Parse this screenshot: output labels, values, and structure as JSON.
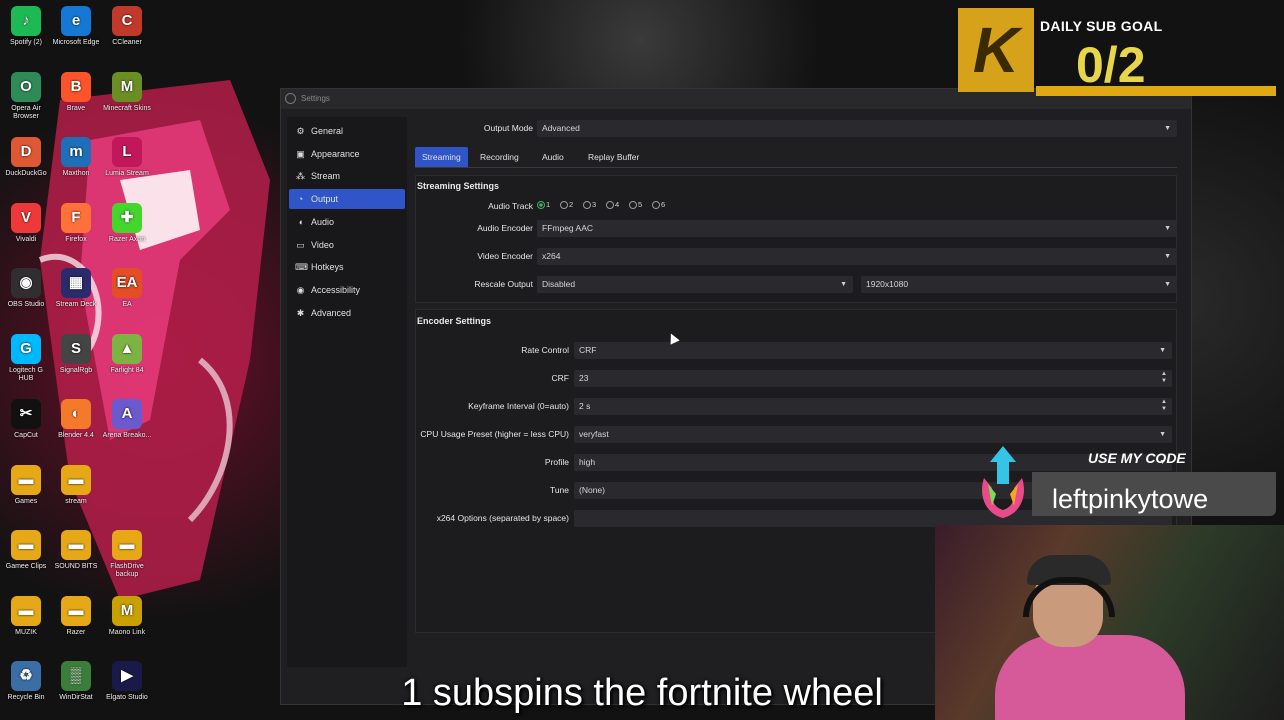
{
  "desktop": {
    "icons": [
      {
        "label": "Spotify (2)",
        "glyph": "♪",
        "color": "#1db954"
      },
      {
        "label": "Microsoft Edge",
        "glyph": "e",
        "color": "#1478d4"
      },
      {
        "label": "CCleaner",
        "glyph": "C",
        "color": "#c0392b"
      },
      {
        "label": "Opera Air Browser",
        "glyph": "O",
        "color": "#2e8b57"
      },
      {
        "label": "Brave",
        "glyph": "B",
        "color": "#fb542b"
      },
      {
        "label": "Minecraft Skins",
        "glyph": "M",
        "color": "#6b8e23"
      },
      {
        "label": "DuckDuckGo",
        "glyph": "D",
        "color": "#de5833"
      },
      {
        "label": "Maxthon",
        "glyph": "m",
        "color": "#1d6fb8"
      },
      {
        "label": "Lumia Stream",
        "glyph": "L",
        "color": "#c2185b"
      },
      {
        "label": "Vivaldi",
        "glyph": "V",
        "color": "#ef3939"
      },
      {
        "label": "Firefox",
        "glyph": "F",
        "color": "#ff7139"
      },
      {
        "label": "Razer Axon",
        "glyph": "✚",
        "color": "#44d62c"
      },
      {
        "label": "OBS Studio",
        "glyph": "◉",
        "color": "#302e31"
      },
      {
        "label": "Stream Deck",
        "glyph": "▦",
        "color": "#2b2b6b"
      },
      {
        "label": "EA",
        "glyph": "EA",
        "color": "#e44d26"
      },
      {
        "label": "Logitech G HUB",
        "glyph": "G",
        "color": "#00b8fc"
      },
      {
        "label": "SignalRgb",
        "glyph": "S",
        "color": "#444"
      },
      {
        "label": "Farlight 84",
        "glyph": "▲",
        "color": "#7cb342"
      },
      {
        "label": "CapCut",
        "glyph": "✂",
        "color": "#111"
      },
      {
        "label": "Blender 4.4",
        "glyph": "◐",
        "color": "#f5792a"
      },
      {
        "label": "Arena Breako...",
        "glyph": "A",
        "color": "#6a5acd"
      },
      {
        "label": "Games",
        "glyph": "▬",
        "color": "#e6a817"
      },
      {
        "label": "stream",
        "glyph": "▬",
        "color": "#e6a817"
      },
      {
        "label": "",
        "glyph": "",
        "color": "transparent"
      },
      {
        "label": "Gamee Clips",
        "glyph": "▬",
        "color": "#e6a817"
      },
      {
        "label": "SOUND BITS",
        "glyph": "▬",
        "color": "#e6a817"
      },
      {
        "label": "FlashDrive backup",
        "glyph": "▬",
        "color": "#e6a817"
      },
      {
        "label": "MUZIK",
        "glyph": "▬",
        "color": "#e6a817"
      },
      {
        "label": "Razer",
        "glyph": "▬",
        "color": "#e6a817"
      },
      {
        "label": "Maono Link",
        "glyph": "M",
        "color": "#c8a000"
      },
      {
        "label": "Recycle Bin",
        "glyph": "♻",
        "color": "#3a6ea5"
      },
      {
        "label": "WinDirStat",
        "glyph": "▒",
        "color": "#3b7d3b"
      },
      {
        "label": "Elgato Studio",
        "glyph": "▶",
        "color": "#1a1a4a"
      }
    ]
  },
  "window": {
    "title": "Settings",
    "nav": [
      {
        "label": "General",
        "icon": "⚙"
      },
      {
        "label": "Appearance",
        "icon": "▣"
      },
      {
        "label": "Stream",
        "icon": "⁂"
      },
      {
        "label": "Output",
        "icon": "◔"
      },
      {
        "label": "Audio",
        "icon": "◖"
      },
      {
        "label": "Video",
        "icon": "▭"
      },
      {
        "label": "Hotkeys",
        "icon": "⌨"
      },
      {
        "label": "Accessibility",
        "icon": "◉"
      },
      {
        "label": "Advanced",
        "icon": "✱"
      }
    ],
    "active_nav": "Output",
    "output_mode": {
      "label": "Output Mode",
      "value": "Advanced"
    },
    "tabs": [
      "Streaming",
      "Recording",
      "Audio",
      "Replay Buffer"
    ],
    "active_tab": "Streaming",
    "streaming_settings": {
      "title": "Streaming Settings",
      "audio_track_label": "Audio Track",
      "audio_tracks": [
        "1",
        "2",
        "3",
        "4",
        "5",
        "6"
      ],
      "audio_track_selected": "1",
      "audio_encoder": {
        "label": "Audio Encoder",
        "value": "FFmpeg AAC"
      },
      "video_encoder": {
        "label": "Video Encoder",
        "value": "x264"
      },
      "rescale_output": {
        "label": "Rescale Output",
        "value": "Disabled",
        "resolution": "1920x1080"
      }
    },
    "encoder_settings": {
      "title": "Encoder Settings",
      "rate_control": {
        "label": "Rate Control",
        "value": "CRF"
      },
      "crf": {
        "label": "CRF",
        "value": "23"
      },
      "keyframe": {
        "label": "Keyframe Interval (0=auto)",
        "value": "2 s"
      },
      "cpu_preset": {
        "label": "CPU Usage Preset (higher = less CPU)",
        "value": "veryfast"
      },
      "profile": {
        "label": "Profile",
        "value": "high"
      },
      "tune": {
        "label": "Tune",
        "value": "(None)"
      },
      "x264_options": {
        "label": "x264 Options (separated by space)",
        "value": ""
      }
    }
  },
  "overlays": {
    "sub_goal": {
      "title": "DAILY SUB GOAL",
      "count": "0/2",
      "logo": "K"
    },
    "code": {
      "title": "USE MY CODE",
      "name": "leftpinkytowe"
    },
    "caption": "1 subspins the fortnite wheel"
  }
}
